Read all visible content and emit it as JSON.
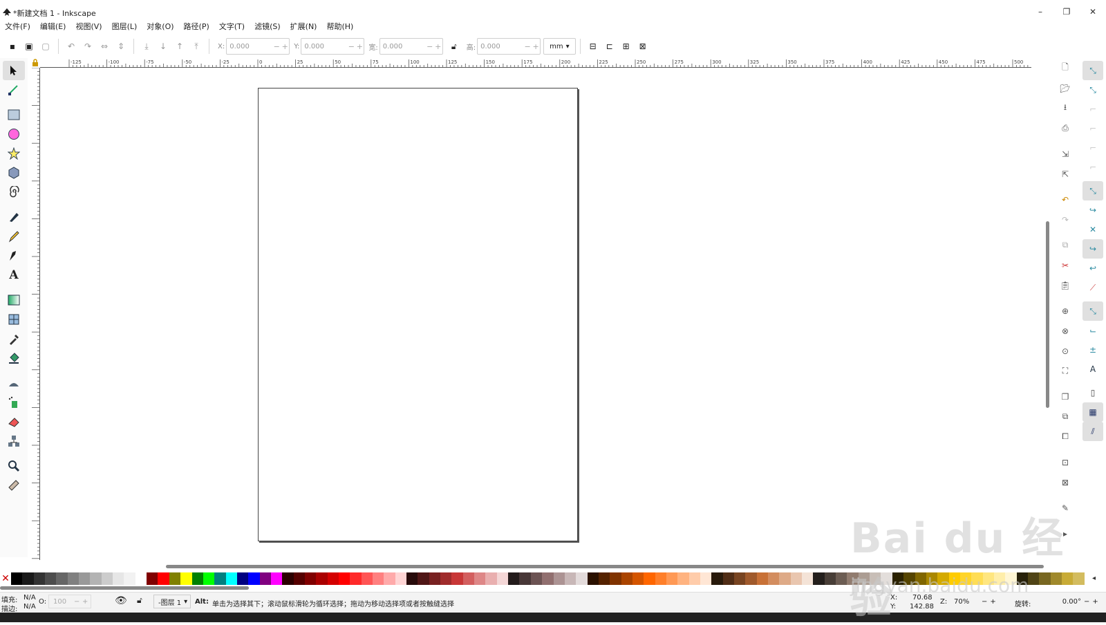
{
  "window": {
    "title": "*新建文档 1 - Inkscape",
    "minimize": "–",
    "restore": "❐",
    "close": "✕"
  },
  "menu": [
    "文件(F)",
    "编辑(E)",
    "视图(V)",
    "图层(L)",
    "对象(O)",
    "路径(P)",
    "文字(T)",
    "滤镜(S)",
    "扩展(N)",
    "帮助(H)"
  ],
  "toolbar": {
    "x_label": "X:",
    "x_value": "0.000",
    "y_label": "Y:",
    "y_value": "0.000",
    "w_label": "宽:",
    "w_value": "0.000",
    "h_label": "高:",
    "h_value": "0.000",
    "unit": "mm"
  },
  "ruler": {
    "h_ticks": [
      "-125",
      "-100",
      "-75",
      "-50",
      "-25",
      "0",
      "25",
      "50",
      "75",
      "100",
      "125",
      "150",
      "175",
      "200",
      "225",
      "250",
      "275",
      "300",
      "325",
      "350",
      "375",
      "400",
      "425",
      "450",
      "475",
      "500"
    ]
  },
  "tools": [
    "selector-tool",
    "node-tool",
    "rect-tool",
    "ellipse-tool",
    "star-tool",
    "box3d-tool",
    "spiral-tool",
    "pen-tool",
    "pencil-tool",
    "calligraphy-tool",
    "text-tool",
    "gradient-tool",
    "mesh-tool",
    "dropper-tool",
    "paintbucket-tool",
    "tweak-tool",
    "spray-tool",
    "eraser-tool",
    "connector-tool",
    "zoom-tool",
    "measure-tool"
  ],
  "palette": [
    "#000000",
    "#1a1a1a",
    "#333333",
    "#4d4d4d",
    "#666666",
    "#808080",
    "#999999",
    "#b3b3b3",
    "#cccccc",
    "#e6e6e6",
    "#f2f2f2",
    "#ffffff",
    "#800000",
    "#ff0000",
    "#808000",
    "#ffff00",
    "#008000",
    "#00ff00",
    "#008080",
    "#00ffff",
    "#000080",
    "#0000ff",
    "#800080",
    "#ff00ff",
    "#2b0000",
    "#550000",
    "#800000",
    "#aa0000",
    "#d40000",
    "#ff0000",
    "#ff2a2a",
    "#ff5555",
    "#ff8080",
    "#ffaaaa",
    "#ffd5d5",
    "#280b0b",
    "#501616",
    "#782121",
    "#a02c2c",
    "#c83737",
    "#d35f5f",
    "#de8787",
    "#e9afaf",
    "#f4d7d7",
    "#241c1c",
    "#483737",
    "#6c5353",
    "#916f6f",
    "#ac9393",
    "#c8b7b7",
    "#e3dbdb",
    "#2b1100",
    "#552200",
    "#803300",
    "#aa4400",
    "#d45500",
    "#ff6600",
    "#ff7f2a",
    "#ff9955",
    "#ffb380",
    "#ffccaa",
    "#ffe6d5",
    "#281a0b",
    "#502d16",
    "#784421",
    "#a05a2c",
    "#c87137",
    "#d38d5f",
    "#deaa87",
    "#e9c6af",
    "#f4e3d7",
    "#241f1c",
    "#483e37",
    "#6c5d53",
    "#917c6f",
    "#ac9d93",
    "#c8beb7",
    "#e3dedb",
    "#2b2200",
    "#554400",
    "#806600",
    "#aa8800",
    "#d4aa00",
    "#ffcc00",
    "#ffd42a",
    "#ffdd55",
    "#ffe680",
    "#ffeeaa",
    "#fff6d5",
    "#28220b",
    "#504416",
    "#786721",
    "#a0892c",
    "#c8ab37",
    "#d3bc5f"
  ],
  "status": {
    "fill_label": "填充:",
    "fill_value": "N/A",
    "stroke_label": "描边:",
    "stroke_value": "N/A",
    "opacity_label": "O:",
    "opacity_value": "100",
    "layer": "-图层 1",
    "message_key": "Alt:",
    "message": "单击为选择其下；滚动鼠标滑轮为循环选择；拖动为移动选择项或者按触缝选择",
    "x_label": "X:",
    "x_value": "70.68",
    "y_label": "Y:",
    "y_value": "142.88",
    "zoom_label": "Z:",
    "zoom_value": "70%",
    "rotate_label": "旋转:",
    "rotate_value": "0.00°"
  },
  "watermark": {
    "brand": "Bai du 经验",
    "url": "jingyan.baidu.com"
  }
}
